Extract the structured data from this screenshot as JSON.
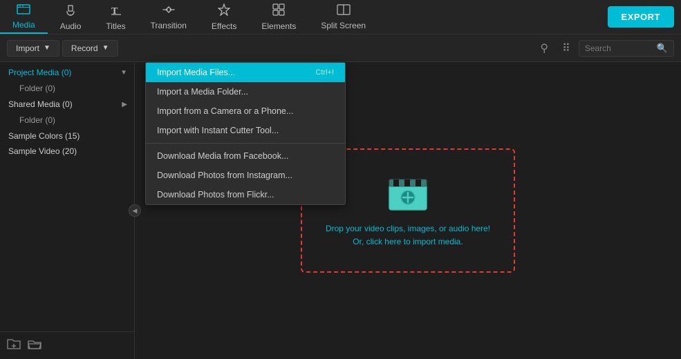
{
  "nav": {
    "items": [
      {
        "label": "Media",
        "icon": "🗂",
        "active": true
      },
      {
        "label": "Audio",
        "icon": "♪"
      },
      {
        "label": "Titles",
        "icon": "T"
      },
      {
        "label": "Transition",
        "icon": "⇄"
      },
      {
        "label": "Effects",
        "icon": "✦"
      },
      {
        "label": "Elements",
        "icon": "▦"
      },
      {
        "label": "Split Screen",
        "icon": "⊞"
      }
    ],
    "export_label": "EXPORT"
  },
  "toolbar": {
    "import_label": "Import",
    "record_label": "Record",
    "search_placeholder": "Search"
  },
  "sidebar": {
    "items": [
      {
        "label": "Project Media (0)",
        "has_chevron": true,
        "active": true
      },
      {
        "label": "Folder (0)",
        "indent": true
      },
      {
        "label": "Shared Media (0)",
        "has_chevron": true
      },
      {
        "label": "Folder (0)",
        "indent": true
      },
      {
        "label": "Sample Colors (15)"
      },
      {
        "label": "Sample Video (20)"
      }
    ],
    "bottom_icons": [
      "folder-add",
      "folder-open"
    ]
  },
  "dropdown": {
    "items": [
      {
        "label": "Import Media Files...",
        "shortcut": "Ctrl+I",
        "highlighted": true
      },
      {
        "label": "Import a Media Folder...",
        "shortcut": ""
      },
      {
        "label": "Import from a Camera or a Phone...",
        "shortcut": ""
      },
      {
        "label": "Import with Instant Cutter Tool...",
        "shortcut": ""
      },
      {
        "divider": true
      },
      {
        "label": "Download Media from Facebook...",
        "shortcut": ""
      },
      {
        "label": "Download Photos from Instagram...",
        "shortcut": ""
      },
      {
        "label": "Download Photos from Flickr...",
        "shortcut": ""
      }
    ]
  },
  "dropzone": {
    "line1": "Drop your video clips, images, or audio here!",
    "line2": "Or, click here to import media."
  }
}
